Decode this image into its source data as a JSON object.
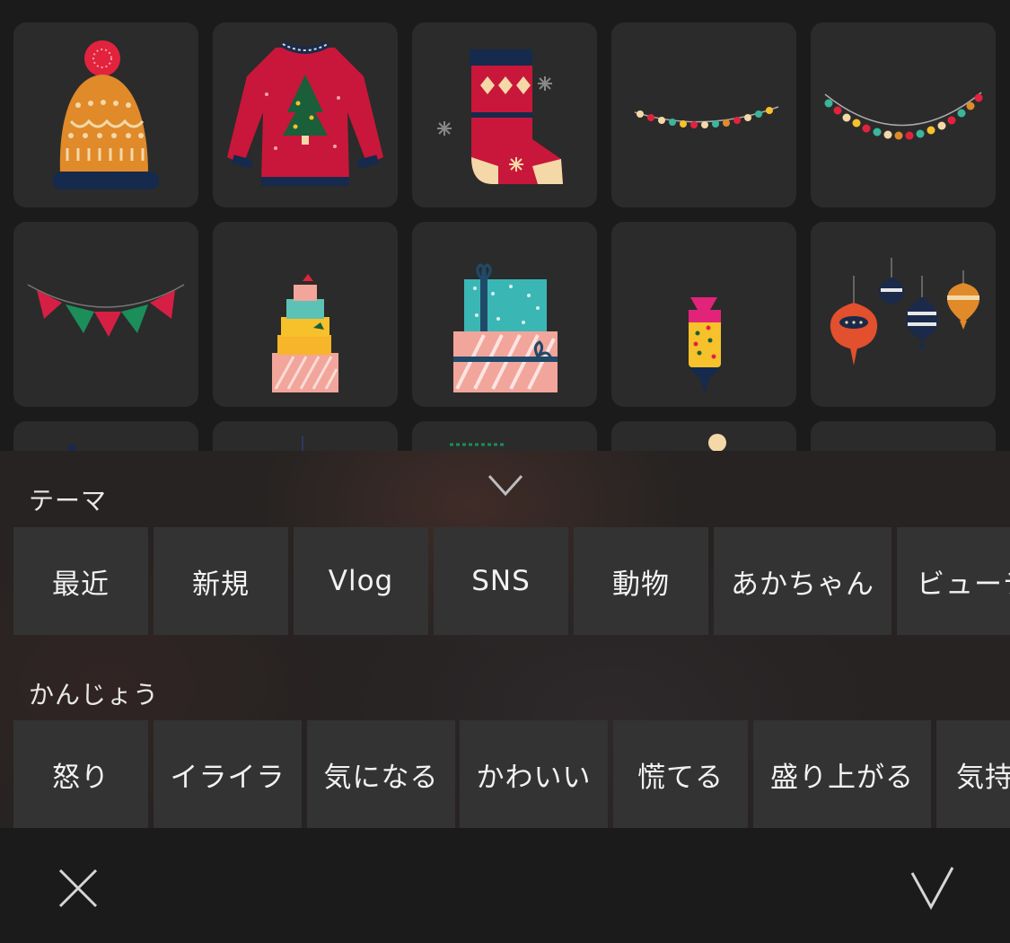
{
  "stickers": [
    {
      "name": "knit-hat-sticker"
    },
    {
      "name": "ugly-sweater-sticker"
    },
    {
      "name": "christmas-stocking-sticker"
    },
    {
      "name": "string-lights-small-sticker"
    },
    {
      "name": "string-lights-large-sticker"
    },
    {
      "name": "bunting-flags-sticker"
    },
    {
      "name": "gift-stack-tall-sticker"
    },
    {
      "name": "gift-boxes-sticker"
    },
    {
      "name": "candy-ornament-sticker"
    },
    {
      "name": "hanging-ornaments-sticker"
    }
  ],
  "panel": {
    "collapse_icon": "chevron-down-icon",
    "theme": {
      "label": "テーマ",
      "items": [
        "最近",
        "新規",
        "Vlog",
        "SNS",
        "動物",
        "あかちゃん",
        "ビューテ"
      ]
    },
    "emotion": {
      "label": "かんじょう",
      "items": [
        "怒り",
        "イライラ",
        "気になる",
        "かわいい",
        "慌てる",
        "盛り上がる",
        "気持"
      ]
    }
  },
  "footer": {
    "cancel_icon": "close-icon",
    "confirm_icon": "check-icon"
  },
  "colors": {
    "background": "#1b1b1b",
    "tile": "#2b2b2b",
    "chip": "#333333",
    "text": "#ffffff"
  }
}
